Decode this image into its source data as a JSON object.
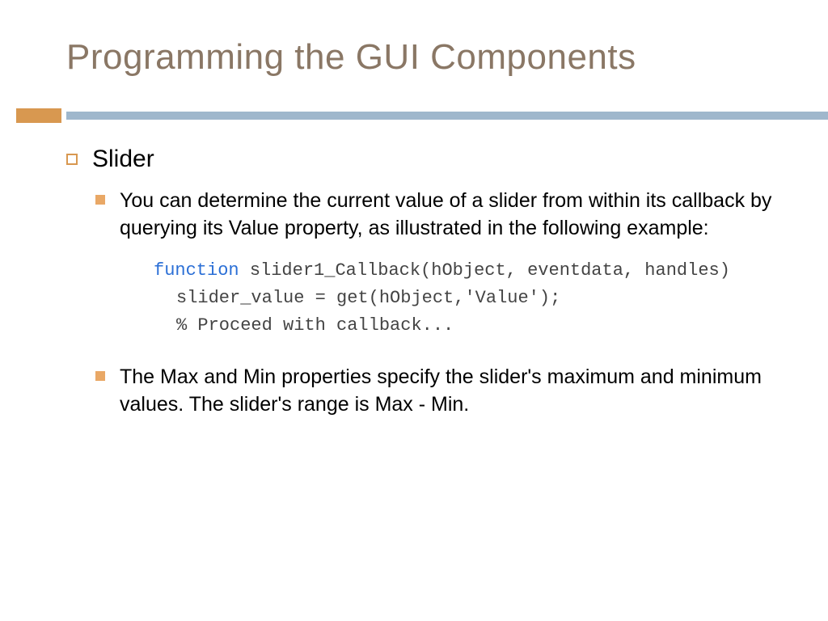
{
  "title": "Programming the GUI Components",
  "bullet1": "Slider",
  "bullet2": "You can determine the current value of a slider from within its callback by querying its Value property, as illustrated in the following example:",
  "code": {
    "keyword": "function",
    "line1_rest": " slider1_Callback(hObject, eventdata, handles)",
    "line2": "slider_value = get(hObject,'Value');",
    "line3": "% Proceed with callback..."
  },
  "bullet3": "The Max and Min properties specify the slider's maximum and minimum values. The slider's range is Max - Min."
}
